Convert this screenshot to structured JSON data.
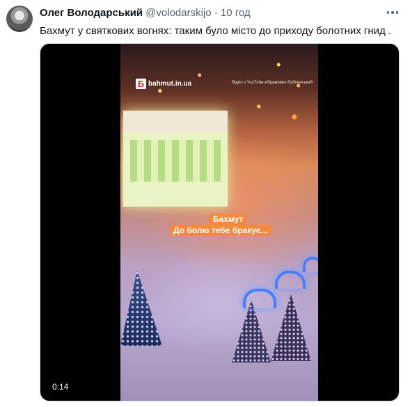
{
  "author": {
    "name": "Олег Володарський",
    "handle": "@volodarskijo",
    "separator": "·",
    "time": "10 год"
  },
  "tweet": {
    "text": "Бахмут у святкових вогнях: таким було місто до приходу болотних гнид ."
  },
  "video": {
    "logo_letter": "Б",
    "logo_site": "bahmut.in.ua",
    "credit": "Відео з YouTube-Абрамович Рубленський",
    "caption_line1": "Бахмут",
    "caption_line2": "До болю тебе бракує...",
    "duration": "0:14"
  },
  "icons": {
    "more": "more-dots-icon"
  }
}
